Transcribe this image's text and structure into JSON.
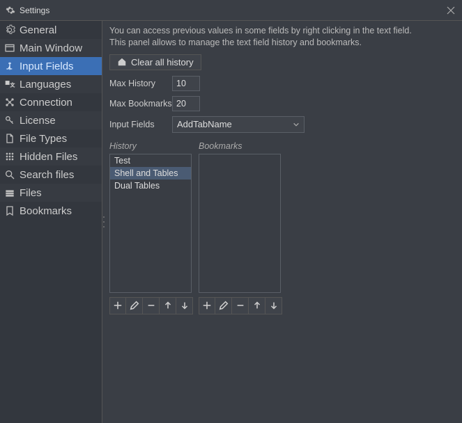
{
  "window": {
    "title": "Settings"
  },
  "sidebar": {
    "items": [
      {
        "label": "General"
      },
      {
        "label": "Main Window"
      },
      {
        "label": "Input Fields"
      },
      {
        "label": "Languages"
      },
      {
        "label": "Connection"
      },
      {
        "label": "License"
      },
      {
        "label": "File Types"
      },
      {
        "label": "Hidden Files"
      },
      {
        "label": "Search files"
      },
      {
        "label": "Files"
      },
      {
        "label": "Bookmarks"
      }
    ],
    "selected_index": 2
  },
  "panel": {
    "description_line1": "You can access previous values in some fields by right clicking in the text field.",
    "description_line2": "This panel allows to manage the text field history and bookmarks.",
    "clear_label": "Clear all history",
    "max_history_label": "Max History",
    "max_history_value": "10",
    "max_bookmarks_label": "Max Bookmarks",
    "max_bookmarks_value": "20",
    "input_fields_label": "Input Fields",
    "input_fields_value": "AddTabName",
    "history_label": "History",
    "bookmarks_label": "Bookmarks",
    "history_items": [
      {
        "label": "Test"
      },
      {
        "label": "Shell and Tables"
      },
      {
        "label": "Dual Tables"
      }
    ],
    "history_selected_index": 1
  }
}
